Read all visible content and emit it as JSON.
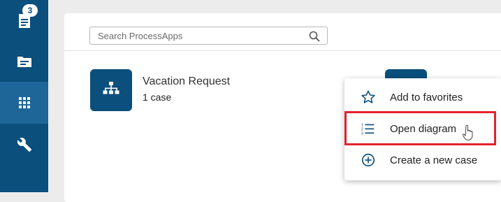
{
  "sidebar": {
    "items": [
      {
        "id": "tasks",
        "icon": "tasks-list-icon",
        "badge": "3"
      },
      {
        "id": "folders",
        "icon": "folder-icon"
      },
      {
        "id": "apps",
        "icon": "grid-apps-icon",
        "active": true
      },
      {
        "id": "tools",
        "icon": "wrench-icon"
      }
    ],
    "background": "#0b4f7c",
    "active_background": "#1d6697"
  },
  "search": {
    "placeholder": "Search ProcessApps",
    "value": ""
  },
  "apps": [
    {
      "name": "Vacation Request",
      "count": "1 case",
      "icon": "org-chart-icon"
    }
  ],
  "context_menu": {
    "items": [
      {
        "label": "Add to favorites",
        "icon": "star-outline-icon"
      },
      {
        "label": "Open diagram",
        "icon": "numbered-list-icon",
        "highlighted": true
      },
      {
        "label": "Create a new case",
        "icon": "plus-circle-icon"
      }
    ],
    "highlight_color": "#e0232d"
  },
  "colors": {
    "brand": "#0b4f7c",
    "page_background": "#ececec"
  }
}
